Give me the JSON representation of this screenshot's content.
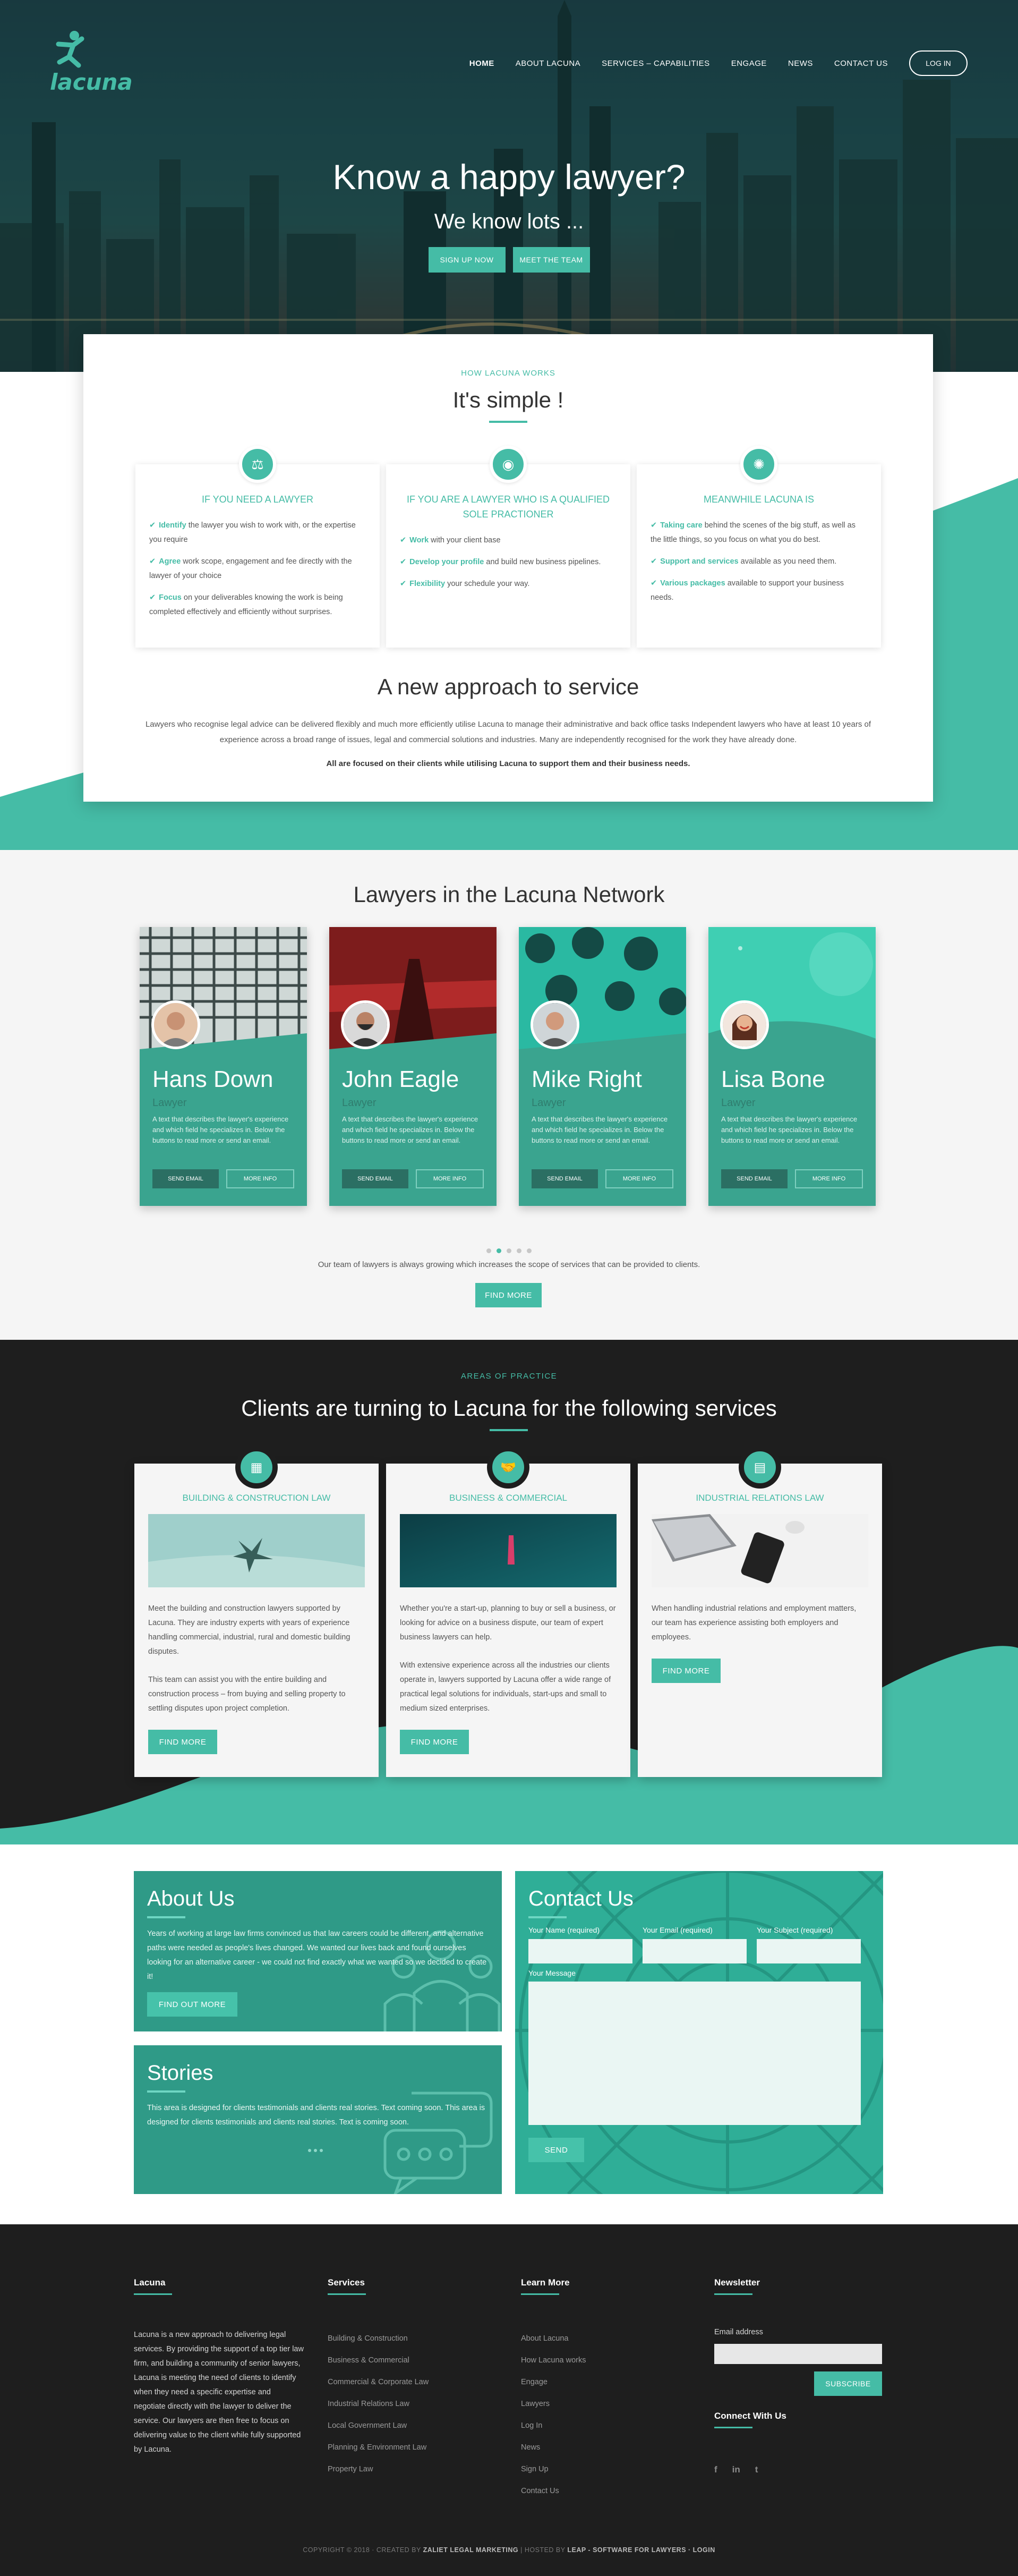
{
  "brand": {
    "name": "lacuna",
    "accent": "#45bca6",
    "dark": "#1e1e1e"
  },
  "nav": {
    "items": [
      "HOME",
      "ABOUT LACUNA",
      "SERVICES – CAPABILITIES",
      "ENGAGE",
      "NEWS",
      "CONTACT US"
    ],
    "login": "LOG IN"
  },
  "hero": {
    "title": "Know a happy lawyer?",
    "subtitle": "We know lots ...",
    "cta_signup": "SIGN UP NOW",
    "cta_team": "MEET THE TEAM"
  },
  "how": {
    "eyebrow": "HOW LACUNA WORKS",
    "title": "It's simple !",
    "columns": [
      {
        "icon": "gavel-icon",
        "heading": "IF YOU NEED A LAWYER",
        "items": [
          {
            "kw": "Identify",
            "rest": " the lawyer you wish to work with, or the expertise you require"
          },
          {
            "kw": "Agree",
            "rest": " work scope, engagement and fee directly with the lawyer of your choice"
          },
          {
            "kw": "Focus",
            "rest": " on your deliverables knowing the work is being completed effectively and efficiently without surprises."
          }
        ]
      },
      {
        "icon": "badge-icon",
        "heading": "IF YOU ARE A LAWYER WHO IS A QUALIFIED SOLE PRACTIONER",
        "items": [
          {
            "kw": "Work",
            "rest": " with your client base"
          },
          {
            "kw": "Develop your profile",
            "rest": " and build new business pipelines."
          },
          {
            "kw": "Flexibility",
            "rest": " your schedule your way."
          }
        ]
      },
      {
        "icon": "lightbulb-icon",
        "heading": "MEANWHILE LACUNA IS",
        "items": [
          {
            "kw": "Taking care",
            "rest": " behind the scenes of the big stuff, as well as the little things, so you focus on what you do best."
          },
          {
            "kw": "Support and services",
            "rest": " available as you need them."
          },
          {
            "kw": "Various packages",
            "rest": " available to support your business needs."
          }
        ]
      }
    ],
    "approach_title": "A new approach to service",
    "approach_body": "Lawyers who recognise legal advice can be delivered flexibly and much more efficiently utilise Lacuna to manage their administrative and back office tasks Independent lawyers who have at least 10 years of experience across a broad range of issues, legal and commercial solutions and industries. Many are independently recognised for the work they have already done.",
    "approach_strong": "All are focused on their clients while utilising Lacuna to support them and their business needs."
  },
  "lawyers": {
    "title": "Lawyers in the Lacuna Network",
    "cards": [
      {
        "name": "Hans Down",
        "role": "Lawyer",
        "desc": "A text that describes the lawyer's experience and which field he specializes in. Below the buttons to read more or send an email.",
        "send": "SEND EMAIL",
        "more": "MORE INFO"
      },
      {
        "name": "John Eagle",
        "role": "Lawyer",
        "desc": "A text that describes the lawyer's experience and which field he specializes in. Below the buttons to read more or send an email.",
        "send": "SEND EMAIL",
        "more": "MORE INFO"
      },
      {
        "name": "Mike Right",
        "role": "Lawyer",
        "desc": "A text that describes the lawyer's experience and which field he specializes in. Below the buttons to read more or send an email.",
        "send": "SEND EMAIL",
        "more": "MORE INFO"
      },
      {
        "name": "Lisa Bone",
        "role": "Lawyer",
        "desc": "A text that describes the lawyer's experience and which field he specializes in. Below the buttons to read more or send an email.",
        "send": "SEND EMAIL",
        "more": "MORE INFO"
      }
    ],
    "note": "Our team of lawyers is always growing which increases the scope of services that can be provided to clients.",
    "find_more": "FIND MORE"
  },
  "services": {
    "eyebrow": "AREAS OF PRACTICE",
    "title": "Clients are turning to Lacuna for the following services",
    "cards": [
      {
        "icon": "building-icon",
        "heading": "BUILDING & CONSTRUCTION LAW",
        "paras": [
          "Meet the building and construction lawyers supported by Lacuna. They are industry experts with years of experience handling commercial, industrial, rural and domestic building disputes.",
          "This team can assist you with the entire building and construction process – from buying and selling property to settling disputes upon project completion."
        ],
        "find": "FIND MORE"
      },
      {
        "icon": "handshake-icon",
        "heading": "BUSINESS & COMMERCIAL",
        "paras": [
          "Whether you're a start-up, planning to buy or sell a business, or looking for advice on a business dispute, our team of expert business lawyers can help.",
          "With extensive experience across all the industries our clients operate in, lawyers supported by Lacuna offer a wide range of practical legal solutions for individuals, start-ups and small to medium sized enterprises."
        ],
        "find": "FIND MORE"
      },
      {
        "icon": "id-card-icon",
        "heading": "INDUSTRIAL RELATIONS LAW",
        "paras": [
          "When handling industrial relations and employment matters, our team has experience assisting both employers and employees."
        ],
        "find": "FIND MORE"
      }
    ]
  },
  "about": {
    "title": "About Us",
    "body": "Years of working at large law firms convinced us that law careers could be different, and alternative paths were needed as people's lives changed. We wanted our lives back and found ourselves looking for an alternative career - we could not find exactly what we wanted so we decided to create it!",
    "button": "FIND OUT MORE"
  },
  "stories": {
    "title": "Stories",
    "body": "This area is designed for clients testimonials and clients real stories. Text coming soon. This area is designed for clients testimonials and clients real stories. Text is coming soon."
  },
  "contact": {
    "title": "Contact Us",
    "name_label": "Your Name (required)",
    "email_label": "Your Email (required)",
    "subject_label": "Your Subject (required)",
    "message_label": "Your Message",
    "send": "SEND"
  },
  "footer": {
    "about_title": "Lacuna",
    "about_text": "Lacuna is a new approach to delivering legal services. By providing the support of a top tier law firm, and building a community of senior lawyers, Lacuna is meeting the need of clients to identify when they need a specific expertise and negotiate directly with the lawyer to deliver the service. Our lawyers are then free to focus on delivering value to the client while fully supported by Lacuna.",
    "services_title": "Services",
    "services_links": [
      "Building & Construction",
      "Business & Commercial",
      "Commercial & Corporate Law",
      "Industrial Relations Law",
      "Local Government Law",
      "Planning & Environment Law",
      "Property Law"
    ],
    "learn_title": "Learn More",
    "learn_links": [
      "About Lacuna",
      "How Lacuna works",
      "Engage",
      "Lawyers",
      "Log In",
      "News",
      "Sign Up",
      "Contact Us"
    ],
    "newsletter_title": "Newsletter",
    "email_label": "Email address",
    "subscribe": "SUBSCRIBE",
    "connect_title": "Connect With Us",
    "social": [
      "f",
      "in",
      "t"
    ],
    "copyright_pre": "COPYRIGHT © 2018 · CREATED BY",
    "creator": "ZALIET LEGAL MARKETING",
    "hosted_pre": "| HOSTED BY",
    "host": "LEAP - SOFTWARE FOR LAWYERS",
    "login": "· LOGIN"
  }
}
